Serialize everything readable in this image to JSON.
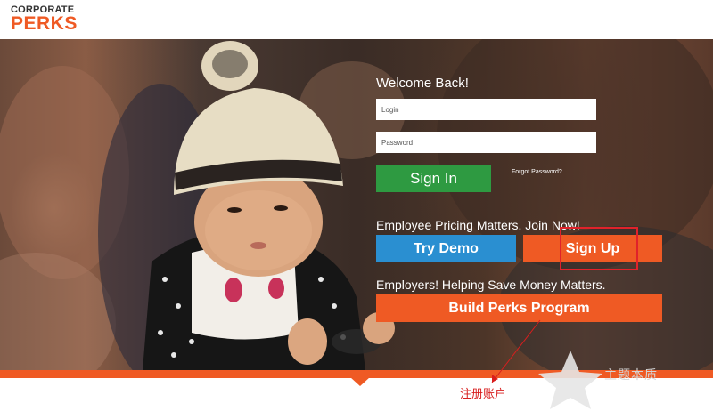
{
  "brand": {
    "logo_top": "CORPORATE",
    "logo_bottom": "PERKS",
    "accent": "#ef5a24"
  },
  "login": {
    "welcome": "Welcome Back!",
    "login_placeholder": "Login",
    "password_placeholder": "Password",
    "signin_label": "Sign In",
    "forgot_label": "Forgot Password?"
  },
  "employee": {
    "tagline": "Employee Pricing Matters. Join Now!",
    "try_demo_label": "Try Demo",
    "sign_up_label": "Sign Up"
  },
  "employer": {
    "tagline": "Employers! Helping Save Money Matters.",
    "build_label": "Build Perks Program"
  },
  "annotation": {
    "text": "注册账户",
    "color": "#d81e1e"
  },
  "watermark": {
    "text": "主题本质"
  },
  "colors": {
    "signin": "#2e9a41",
    "try_demo": "#2a8fd1",
    "orange": "#ef5a24"
  }
}
